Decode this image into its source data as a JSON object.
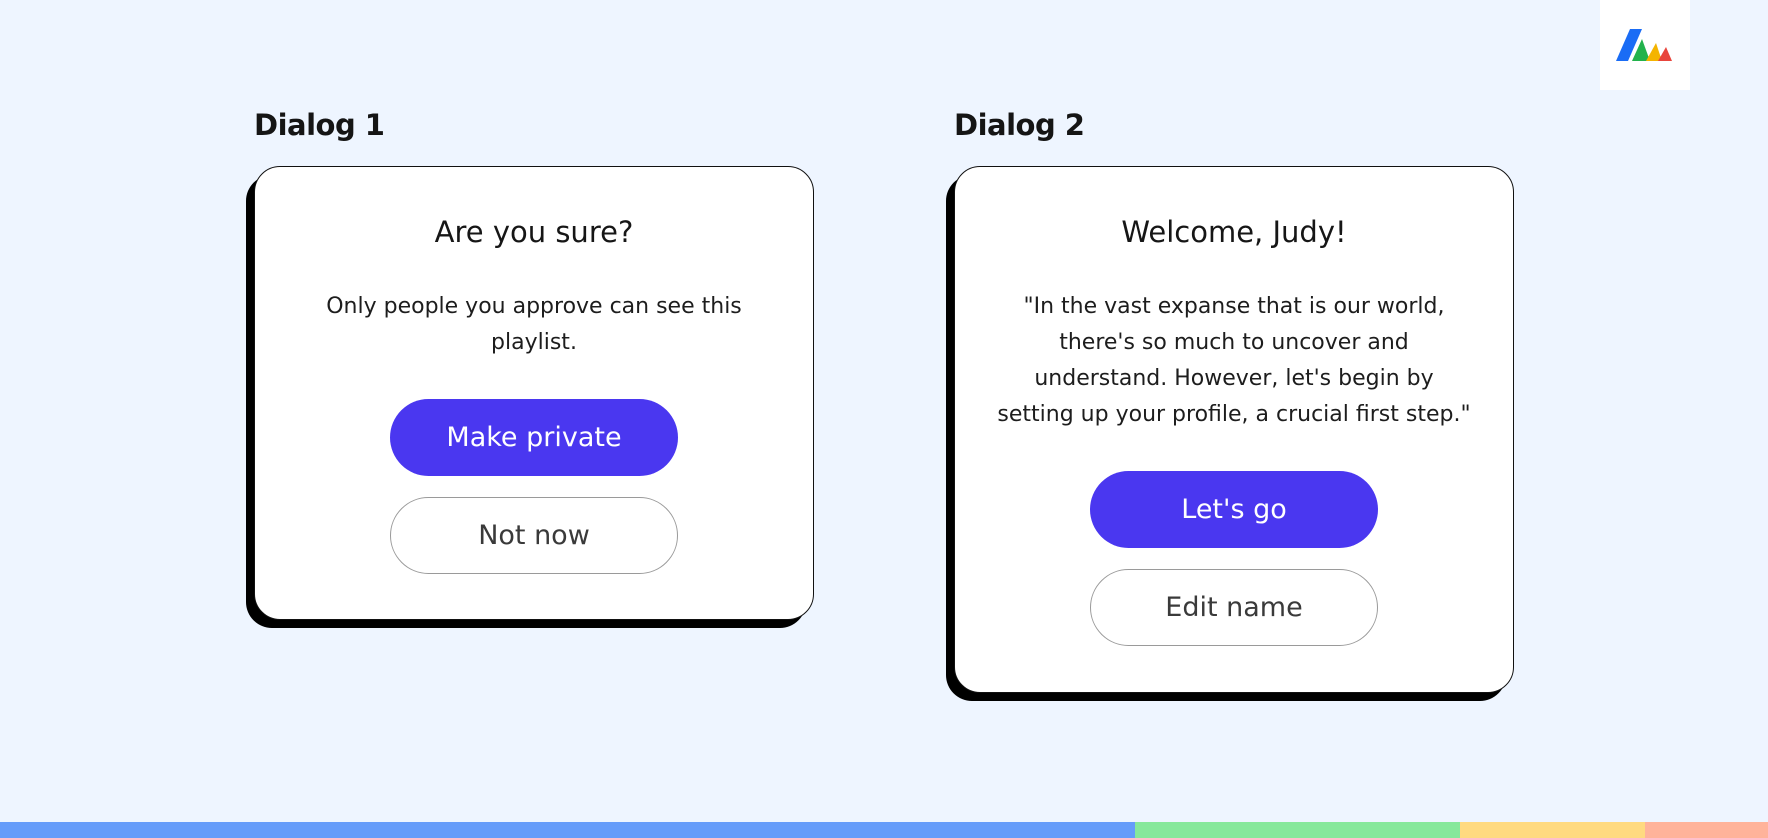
{
  "logo": {
    "icon": "brand-logo-icon",
    "colors": [
      "#1a6cf5",
      "#22b24c",
      "#f4b400",
      "#e8453c"
    ]
  },
  "dialogs": [
    {
      "label": "Dialog 1",
      "title": "Are you sure?",
      "body_lines": [
        "Only people you approve can see this",
        "playlist."
      ],
      "primary_label": "Make private",
      "secondary_label": "Not now"
    },
    {
      "label": "Dialog 2",
      "title": "Welcome, Judy!",
      "body_lines": [
        "\"In the vast expanse that is our world,",
        "there's so much to uncover and",
        "understand. However, let's begin by",
        "setting up your profile, a crucial first step.\""
      ],
      "primary_label": "Let's go",
      "secondary_label": "Edit name"
    }
  ],
  "colors": {
    "background": "#eef5ff",
    "primary_button": "#4a37f0",
    "bottom_bar": [
      "#659cfa",
      "#86e89b",
      "#ffda80",
      "#ffb39a"
    ]
  }
}
